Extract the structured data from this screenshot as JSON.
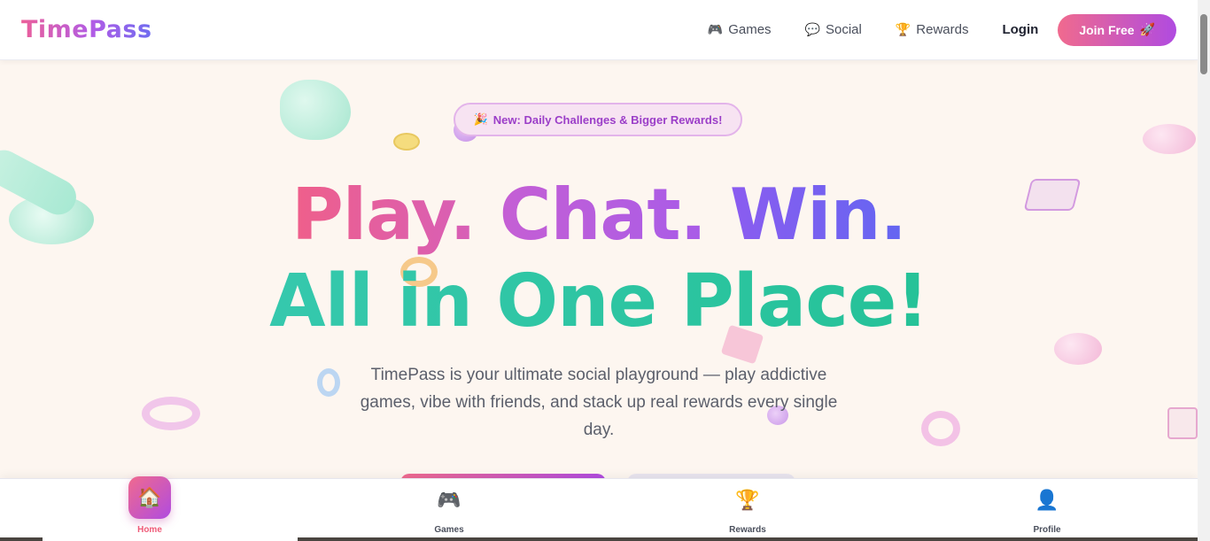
{
  "header": {
    "logo": "TimePass",
    "nav": [
      {
        "icon": "🎮",
        "icon_name": "gamepad-icon",
        "label": "Games"
      },
      {
        "icon": "💬",
        "icon_name": "chat-bubble-icon",
        "label": "Social"
      },
      {
        "icon": "🏆",
        "icon_name": "trophy-icon",
        "label": "Rewards"
      }
    ],
    "login": "Login",
    "join": {
      "label": "Join Free",
      "icon": "🚀",
      "icon_name": "rocket-icon"
    }
  },
  "hero": {
    "badge": {
      "icon": "🎉",
      "icon_name": "party-popper-icon",
      "text": "New: Daily Challenges & Bigger Rewards!"
    },
    "headline_line1": [
      "Play.",
      "Chat.",
      "Win."
    ],
    "headline_line2": "All in One Place!",
    "subtitle": "TimePass is your ultimate social playground — play addictive games, vibe with friends, and stack up real rewards every single day."
  },
  "bottom_nav": [
    {
      "icon": "🏠",
      "icon_name": "home-icon",
      "label": "Home",
      "active": true
    },
    {
      "icon": "🎮",
      "icon_name": "gamepad-icon",
      "label": "Games",
      "active": false
    },
    {
      "icon": "🏆",
      "icon_name": "trophy-icon",
      "label": "Rewards",
      "active": false
    },
    {
      "icon": "👤",
      "icon_name": "user-icon",
      "label": "Profile",
      "active": false
    }
  ],
  "colors": {
    "brand_pink": "#ef5f8a",
    "brand_purple": "#a85ce8",
    "brand_indigo": "#6366f1",
    "brand_teal": "#2fc7a8",
    "background": "#fdf6f0"
  }
}
